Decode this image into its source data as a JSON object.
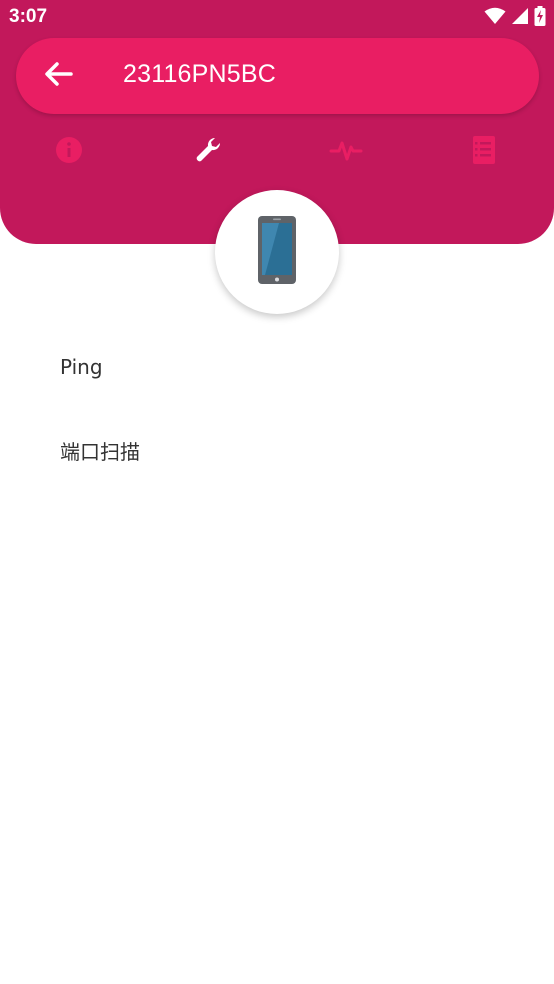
{
  "status_bar": {
    "time": "3:07",
    "icons": [
      "wifi-icon",
      "signal-icon",
      "battery-charging-icon"
    ]
  },
  "header": {
    "title": "23116PN5BC",
    "back_icon": "arrow-left-icon",
    "background_color": "#c2185b",
    "bar_color": "#e91e63"
  },
  "tabs": [
    {
      "icon": "info-icon",
      "active": false
    },
    {
      "icon": "wrench-icon",
      "active": true
    },
    {
      "icon": "pulse-icon",
      "active": false
    },
    {
      "icon": "notebook-icon",
      "active": false
    }
  ],
  "device_icon": "smartphone-icon",
  "tools": {
    "items": [
      {
        "label": "Ping"
      },
      {
        "label": "端口扫描"
      }
    ]
  }
}
